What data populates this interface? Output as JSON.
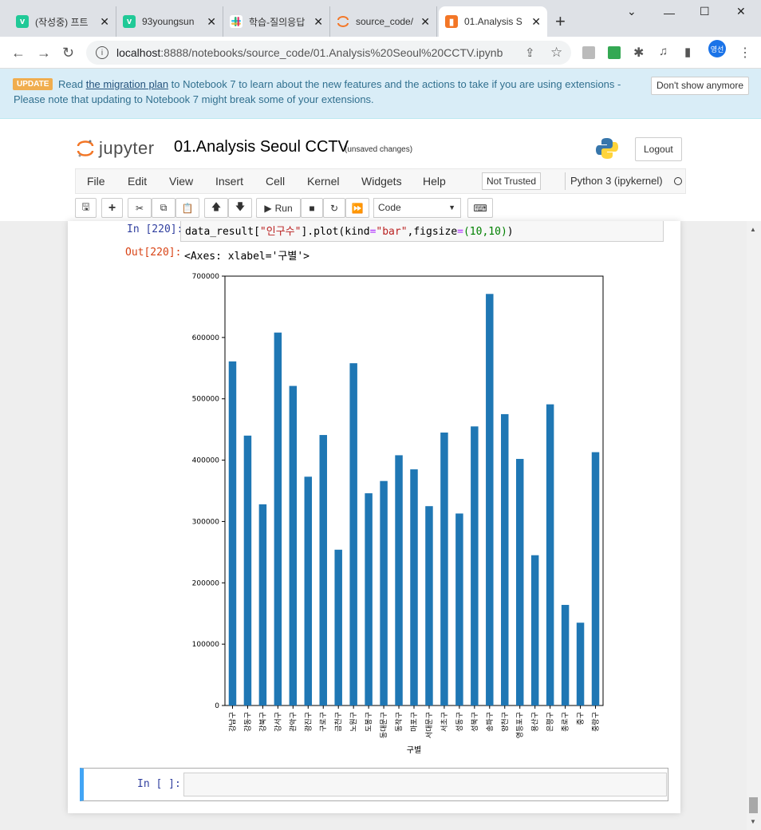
{
  "browser": {
    "tabs": [
      {
        "title": "(작성중) 프트",
        "icon": "v-icon",
        "color": "#20c997"
      },
      {
        "title": "93youngsun",
        "icon": "v-icon",
        "color": "#20c997"
      },
      {
        "title": "학습-질의응답",
        "icon": "slack-icon",
        "color": "#e01e5a"
      },
      {
        "title": "source_code/",
        "icon": "jupyter-icon",
        "color": "#f37626"
      },
      {
        "title": "01.Analysis S",
        "icon": "notebook-icon",
        "color": "#f37626"
      }
    ],
    "url_host": "localhost",
    "url_rest": ":8888/notebooks/source_code/01.Analysis%20Seoul%20CCTV.ipynb",
    "profile": "영선"
  },
  "banner": {
    "badge": "UPDATE",
    "pre": "Read ",
    "link": "the migration plan",
    "post": " to Notebook 7 to learn about the new features and the actions to take if you are using extensions - Please note that updating to Notebook 7 might break some of your extensions.",
    "dismiss": "Don't show anymore"
  },
  "header": {
    "logo_text": "jupyter",
    "notebook_name": "01.Analysis Seoul CCTV",
    "unsaved": "(unsaved changes)",
    "logout": "Logout"
  },
  "menu": {
    "items": [
      "File",
      "Edit",
      "View",
      "Insert",
      "Cell",
      "Kernel",
      "Widgets",
      "Help"
    ],
    "not_trusted": "Not Trusted",
    "kernel": "Python 3 (ipykernel)"
  },
  "toolbar": {
    "run": "Run",
    "cell_type": "Code"
  },
  "cell": {
    "in_prompt": "In [220]:",
    "out_prompt": "Out[220]:",
    "code_pre": "data_result[",
    "code_str1": "\"인구수\"",
    "code_mid": "].plot(kind",
    "code_eq": "=",
    "code_str2": "\"bar\"",
    "code_mid2": ",figsize",
    "code_eq2": "=",
    "code_tuple": "(10,10)",
    "code_end": ")",
    "output_text": "<Axes: xlabel='구별'>",
    "empty_prompt": "In [ ]:"
  },
  "chart_data": {
    "type": "bar",
    "xlabel": "구별",
    "ylabel": "",
    "ylim": [
      0,
      700000
    ],
    "yticks": [
      "0",
      "100000",
      "200000",
      "300000",
      "400000",
      "500000",
      "600000",
      "700000"
    ],
    "bar_color": "#1f77b4",
    "categories": [
      "강남구",
      "강동구",
      "강북구",
      "강서구",
      "관악구",
      "광진구",
      "구로구",
      "금천구",
      "노원구",
      "도봉구",
      "동대문구",
      "동작구",
      "마포구",
      "서대문구",
      "서초구",
      "성동구",
      "성북구",
      "송파구",
      "양천구",
      "영등포구",
      "용산구",
      "은평구",
      "종로구",
      "중구",
      "중랑구"
    ],
    "values": [
      561000,
      440000,
      328000,
      608000,
      521000,
      373000,
      441000,
      254000,
      558000,
      346000,
      366000,
      408000,
      385000,
      325000,
      445000,
      313000,
      455000,
      671000,
      475000,
      402000,
      245000,
      491000,
      164000,
      135000,
      413000
    ]
  }
}
